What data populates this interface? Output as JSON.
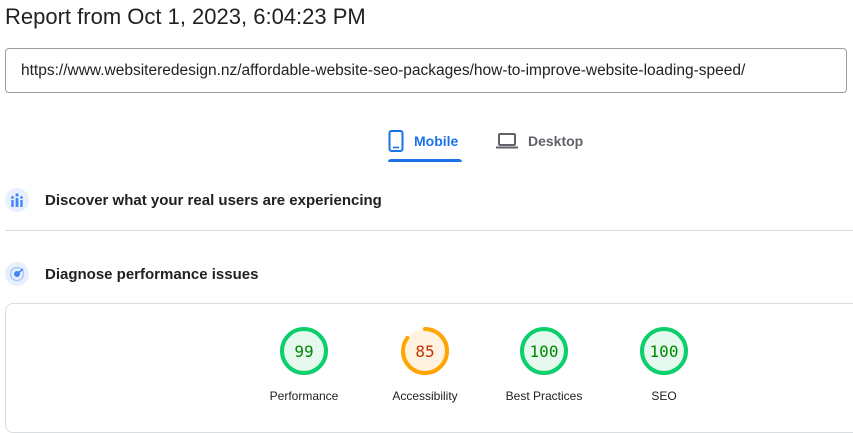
{
  "report": {
    "title": "Report from Oct 1, 2023, 6:04:23 PM",
    "url": "https://www.websiteredesign.nz/affordable-website-seo-packages/how-to-improve-website-loading-speed/"
  },
  "tabs": [
    {
      "label": "Mobile",
      "icon": "smartphone-icon",
      "selected": true
    },
    {
      "label": "Desktop",
      "icon": "laptop-icon",
      "selected": false
    }
  ],
  "sections": {
    "users": {
      "title": "Discover what your real users are experiencing",
      "icon": "users-chart-icon"
    },
    "diagnose": {
      "title": "Diagnose performance issues",
      "icon": "lighthouse-icon"
    }
  },
  "scores": [
    {
      "label": "Performance",
      "value": 99,
      "color": "#0cce6b",
      "text_color": "#008800",
      "fill": "#e6f9ee"
    },
    {
      "label": "Accessibility",
      "value": 85,
      "color": "#ffa400",
      "text_color": "#c33300",
      "fill": "#fff3e0"
    },
    {
      "label": "Best Practices",
      "value": 100,
      "color": "#0cce6b",
      "text_color": "#008800",
      "fill": "#e6f9ee"
    },
    {
      "label": "SEO",
      "value": 100,
      "color": "#0cce6b",
      "text_color": "#008800",
      "fill": "#e6f9ee"
    }
  ],
  "colors": {
    "accent": "#1a73e8",
    "muted": "#5f6368"
  }
}
